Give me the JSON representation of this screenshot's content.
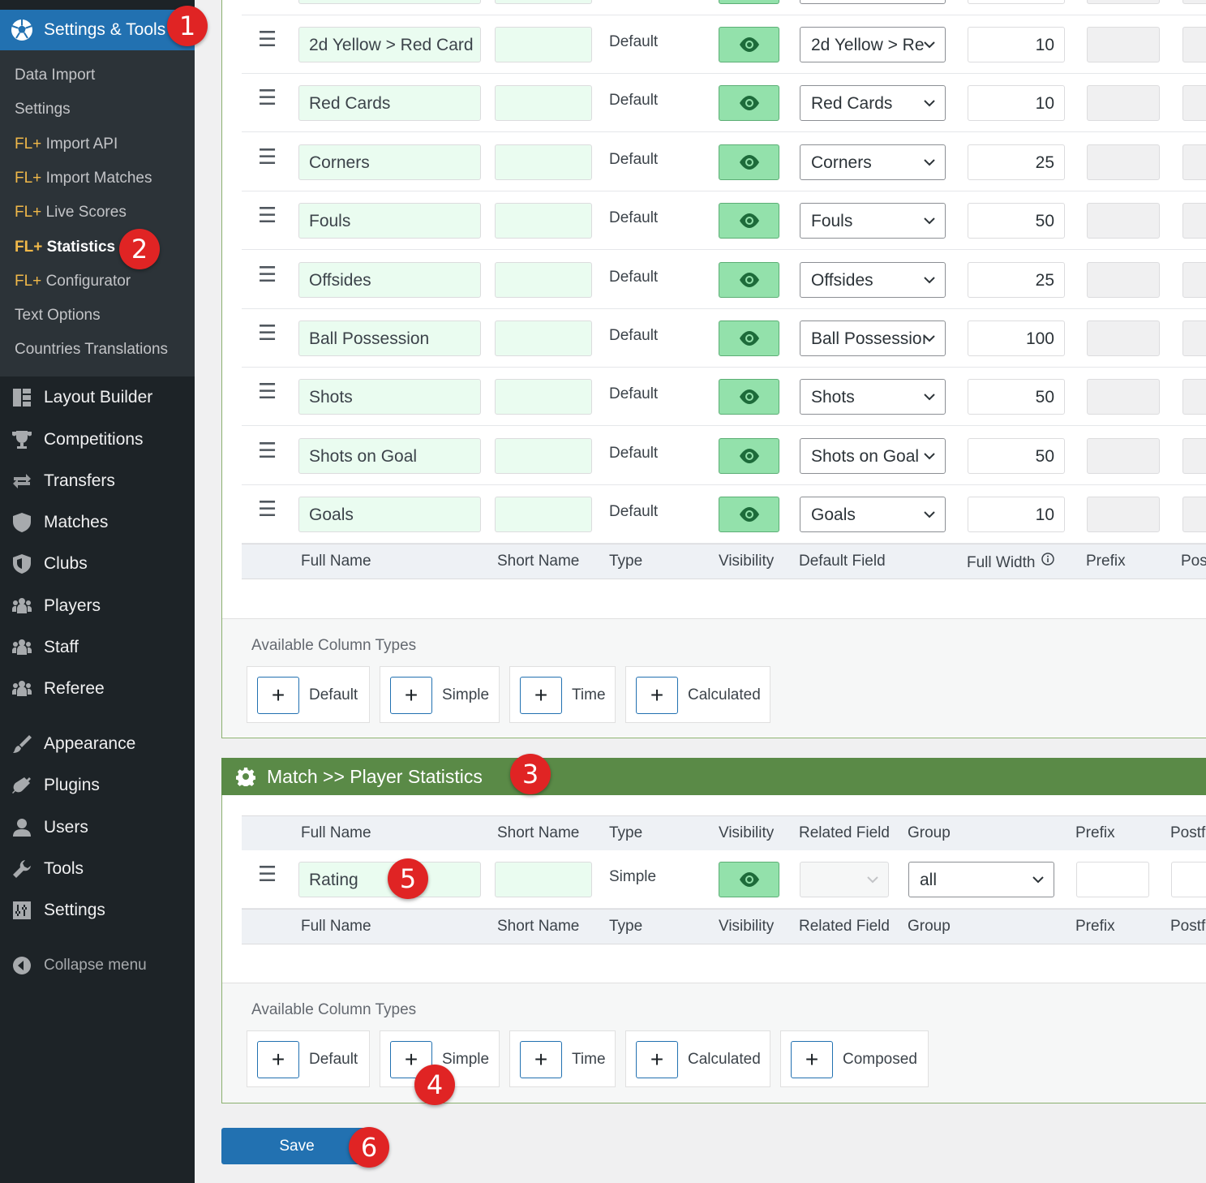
{
  "sidebar": {
    "active_menu": "Settings & Tools",
    "submenu": [
      {
        "prefix": "",
        "label": "Data Import"
      },
      {
        "prefix": "",
        "label": "Settings"
      },
      {
        "prefix": "FL+",
        "label": "Import API"
      },
      {
        "prefix": "FL+",
        "label": "Import Matches"
      },
      {
        "prefix": "FL+",
        "label": "Live Scores"
      },
      {
        "prefix": "FL+",
        "label": "Statistics"
      },
      {
        "prefix": "FL+",
        "label": "Configurator"
      },
      {
        "prefix": "",
        "label": "Text Options"
      },
      {
        "prefix": "",
        "label": "Countries Translations"
      }
    ],
    "menu": [
      {
        "label": "Layout Builder",
        "icon": "layout-icon"
      },
      {
        "label": "Competitions",
        "icon": "trophy-icon"
      },
      {
        "label": "Transfers",
        "icon": "transfer-icon"
      },
      {
        "label": "Matches",
        "icon": "shield-icon"
      },
      {
        "label": "Clubs",
        "icon": "club-shield-icon"
      },
      {
        "label": "Players",
        "icon": "people-icon"
      },
      {
        "label": "Staff",
        "icon": "people-icon"
      },
      {
        "label": "Referee",
        "icon": "people-icon"
      },
      {
        "label": "Appearance",
        "icon": "brush-icon"
      },
      {
        "label": "Plugins",
        "icon": "plug-icon"
      },
      {
        "label": "Users",
        "icon": "user-icon"
      },
      {
        "label": "Tools",
        "icon": "wrench-icon"
      },
      {
        "label": "Settings",
        "icon": "sliders-icon"
      }
    ],
    "collapse": "Collapse menu"
  },
  "team_stats": {
    "rows": [
      {
        "name": "2d Yellow > Red Card",
        "type": "Default",
        "field": "2d Yellow > Re",
        "width": "10"
      },
      {
        "name": "Red Cards",
        "type": "Default",
        "field": "Red Cards",
        "width": "10"
      },
      {
        "name": "Corners",
        "type": "Default",
        "field": "Corners",
        "width": "25"
      },
      {
        "name": "Fouls",
        "type": "Default",
        "field": "Fouls",
        "width": "50"
      },
      {
        "name": "Offsides",
        "type": "Default",
        "field": "Offsides",
        "width": "25"
      },
      {
        "name": "Ball Possession",
        "type": "Default",
        "field": "Ball Possessioı",
        "width": "100"
      },
      {
        "name": "Shots",
        "type": "Default",
        "field": "Shots",
        "width": "50"
      },
      {
        "name": "Shots on Goal",
        "type": "Default",
        "field": "Shots on Goal",
        "width": "50"
      },
      {
        "name": "Goals",
        "type": "Default",
        "field": "Goals",
        "width": "10"
      }
    ],
    "footer": {
      "full_name": "Full Name",
      "short_name": "Short Name",
      "type": "Type",
      "visibility": "Visibility",
      "default_field": "Default Field",
      "full_width": "Full Width",
      "prefix": "Prefix",
      "postfix": "Pos"
    },
    "available_title": "Available Column Types",
    "types": [
      "Default",
      "Simple",
      "Time",
      "Calculated"
    ]
  },
  "player_stats": {
    "title": "Match >> Player Statistics",
    "header": {
      "full_name": "Full Name",
      "short_name": "Short Name",
      "type": "Type",
      "visibility": "Visibility",
      "related_field": "Related Field",
      "group": "Group",
      "prefix": "Prefix",
      "postfix": "Postf"
    },
    "row": {
      "name": "Rating",
      "type": "Simple",
      "group": "all"
    },
    "available_title": "Available Column Types",
    "types": [
      "Default",
      "Simple",
      "Time",
      "Calculated",
      "Composed"
    ]
  },
  "save_label": "Save",
  "badges": [
    "1",
    "2",
    "3",
    "4",
    "5",
    "6"
  ],
  "colors": {
    "sidebar_bg": "#1d2327",
    "submenu_bg": "#2c3338",
    "accent_blue": "#2271b1",
    "section_green": "#5a8a47",
    "visibility_green": "#93e1ab",
    "badge_red": "#e02424",
    "fl_prefix": "#f0b849"
  }
}
